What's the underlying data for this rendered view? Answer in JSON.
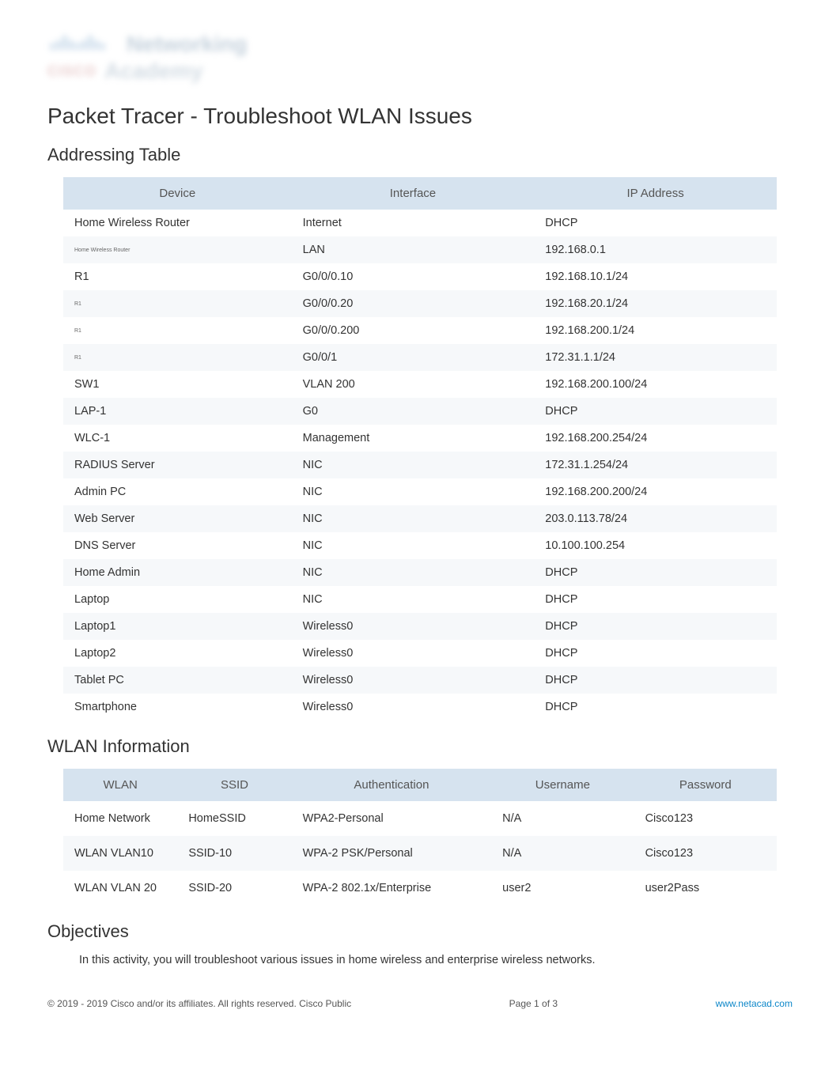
{
  "logo": {
    "text1": "Networking",
    "brand": "CISCO",
    "text2": "Academy"
  },
  "title": "Packet Tracer - Troubleshoot WLAN Issues",
  "addressing": {
    "heading": "Addressing Table",
    "headers": [
      "Device",
      "Interface",
      "IP Address"
    ],
    "rows": [
      {
        "device": "Home Wireless Router",
        "iface": "Internet",
        "ip": "DHCP"
      },
      {
        "device": "Home Wireless Router",
        "small": true,
        "iface": "LAN",
        "ip": "192.168.0.1"
      },
      {
        "device": "R1",
        "iface": "G0/0/0.10",
        "ip": "192.168.10.1/24"
      },
      {
        "device": "R1",
        "small": true,
        "iface": "G0/0/0.20",
        "ip": "192.168.20.1/24"
      },
      {
        "device": "R1",
        "small": true,
        "iface": "G0/0/0.200",
        "ip": "192.168.200.1/24"
      },
      {
        "device": "R1",
        "small": true,
        "iface": "G0/0/1",
        "ip": "172.31.1.1/24"
      },
      {
        "device": "SW1",
        "iface": "VLAN 200",
        "ip": "192.168.200.100/24"
      },
      {
        "device": "LAP-1",
        "iface": "G0",
        "ip": "DHCP"
      },
      {
        "device": "WLC-1",
        "iface": "Management",
        "ip": "192.168.200.254/24"
      },
      {
        "device": "RADIUS Server",
        "iface": "NIC",
        "ip": "172.31.1.254/24"
      },
      {
        "device": "Admin PC",
        "iface": "NIC",
        "ip": "192.168.200.200/24"
      },
      {
        "device": "Web Server",
        "iface": "NIC",
        "ip": "203.0.113.78/24"
      },
      {
        "device": "DNS Server",
        "iface": "NIC",
        "ip": "10.100.100.254"
      },
      {
        "device": "Home Admin",
        "iface": "NIC",
        "ip": "DHCP"
      },
      {
        "device": "Laptop",
        "iface": "NIC",
        "ip": "DHCP"
      },
      {
        "device": "Laptop1",
        "iface": "Wireless0",
        "ip": "DHCP"
      },
      {
        "device": "Laptop2",
        "iface": "Wireless0",
        "ip": "DHCP"
      },
      {
        "device": "Tablet PC",
        "iface": "Wireless0",
        "ip": "DHCP"
      },
      {
        "device": "Smartphone",
        "iface": "Wireless0",
        "ip": "DHCP"
      }
    ]
  },
  "wlan": {
    "heading": "WLAN Information",
    "headers": [
      "WLAN",
      "SSID",
      "Authentication",
      "Username",
      "Password"
    ],
    "rows": [
      {
        "wlan": "Home Network",
        "ssid": "HomeSSID",
        "auth": "WPA2-Personal",
        "user": "N/A",
        "pass": "Cisco123"
      },
      {
        "wlan": "WLAN VLAN10",
        "ssid": "SSID-10",
        "auth": "WPA-2 PSK/Personal",
        "user": "N/A",
        "pass": "Cisco123"
      },
      {
        "wlan": "WLAN VLAN 20",
        "ssid": "SSID-20",
        "auth": "WPA-2 802.1x/Enterprise",
        "user": "user2",
        "pass": "user2Pass"
      }
    ]
  },
  "objectives": {
    "heading": "Objectives",
    "body": "In this activity, you will troubleshoot various issues in home wireless and enterprise wireless networks."
  },
  "footer": {
    "copyright": "© 2019 - 2019 Cisco and/or its affiliates. All rights reserved. Cisco Public",
    "page": "Page  1 of 3",
    "link": "www.netacad.com"
  }
}
